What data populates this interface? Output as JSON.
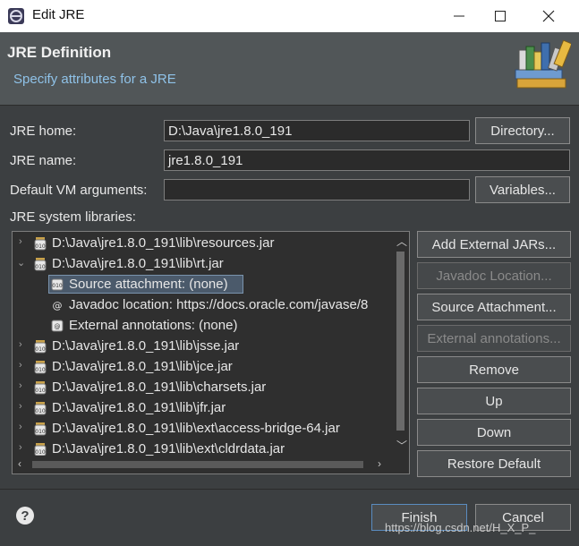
{
  "window": {
    "title": "Edit JRE"
  },
  "header": {
    "title": "JRE Definition",
    "subtitle": "Specify attributes for a JRE"
  },
  "form": {
    "jre_home_label": "JRE home:",
    "jre_home_value": "D:\\Java\\jre1.8.0_191",
    "jre_name_label": "JRE name:",
    "jre_name_value": "jre1.8.0_191",
    "vm_args_label": "Default VM arguments:",
    "vm_args_value": "",
    "libraries_label": "JRE system libraries:"
  },
  "side_buttons": {
    "directory": "Directory...",
    "variables": "Variables..."
  },
  "tree": {
    "rows": [
      {
        "text": "D:\\Java\\jre1.8.0_191\\lib\\resources.jar",
        "expanded": false
      },
      {
        "text": "D:\\Java\\jre1.8.0_191\\lib\\rt.jar",
        "expanded": true
      },
      {
        "text": "Source attachment: (none)",
        "child": true,
        "selected": true
      },
      {
        "text": "Javadoc location: https://docs.oracle.com/javase/8",
        "child": true
      },
      {
        "text": "External annotations: (none)",
        "child": true
      },
      {
        "text": "D:\\Java\\jre1.8.0_191\\lib\\jsse.jar",
        "expanded": false
      },
      {
        "text": "D:\\Java\\jre1.8.0_191\\lib\\jce.jar",
        "expanded": false
      },
      {
        "text": "D:\\Java\\jre1.8.0_191\\lib\\charsets.jar",
        "expanded": false
      },
      {
        "text": "D:\\Java\\jre1.8.0_191\\lib\\jfr.jar",
        "expanded": false
      },
      {
        "text": "D:\\Java\\jre1.8.0_191\\lib\\ext\\access-bridge-64.jar",
        "expanded": false
      },
      {
        "text": "D:\\Java\\jre1.8.0_191\\lib\\ext\\cldrdata.jar",
        "expanded": false
      }
    ]
  },
  "lib_buttons": {
    "add_external": "Add External JARs...",
    "javadoc": "Javadoc Location...",
    "source": "Source Attachment...",
    "external_annotations": "External annotations...",
    "remove": "Remove",
    "up": "Up",
    "down": "Down",
    "restore": "Restore Default"
  },
  "footer": {
    "finish": "Finish",
    "cancel": "Cancel",
    "help_glyph": "?",
    "watermark": "https://blog.csdn.net/H_X_P_"
  },
  "icons": {
    "app": "eclipse-icon",
    "minimize": "minimize-icon",
    "maximize": "maximize-icon",
    "close": "close-icon",
    "banner": "books-icon",
    "jar": "jar-icon",
    "source": "source-attachment-icon",
    "javadoc": "javadoc-icon",
    "annotations": "annotations-icon"
  }
}
